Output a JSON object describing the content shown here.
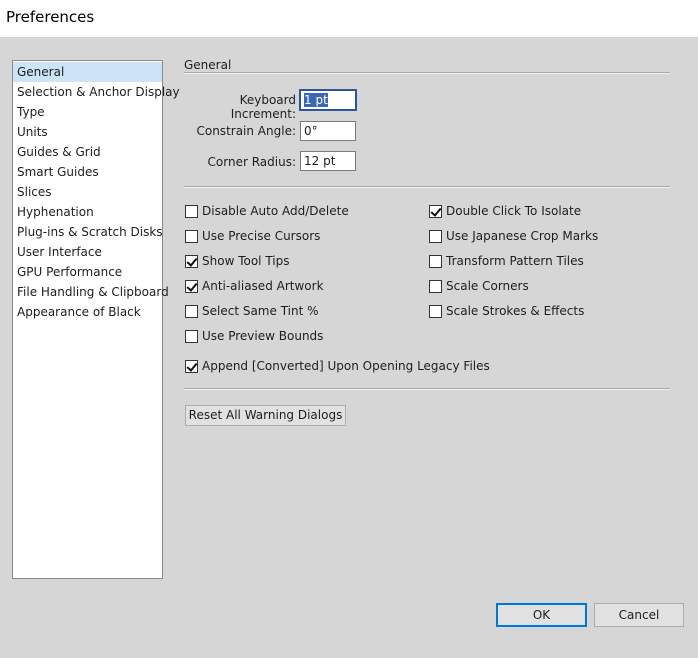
{
  "window": {
    "title": "Preferences"
  },
  "sidebar": {
    "items": [
      {
        "label": "General",
        "selected": true
      },
      {
        "label": "Selection & Anchor Display"
      },
      {
        "label": "Type"
      },
      {
        "label": "Units"
      },
      {
        "label": "Guides & Grid"
      },
      {
        "label": "Smart Guides"
      },
      {
        "label": "Slices"
      },
      {
        "label": "Hyphenation"
      },
      {
        "label": "Plug-ins & Scratch Disks"
      },
      {
        "label": "User Interface"
      },
      {
        "label": "GPU Performance"
      },
      {
        "label": "File Handling & Clipboard"
      },
      {
        "label": "Appearance of Black"
      }
    ]
  },
  "general": {
    "section_title": "General",
    "keyboard_increment": {
      "label": "Keyboard Increment:",
      "value": "1 pt"
    },
    "constrain_angle": {
      "label": "Constrain Angle:",
      "value": "0°"
    },
    "corner_radius": {
      "label": "Corner Radius:",
      "value": "12 pt"
    },
    "checkboxes": {
      "disable_auto_add": {
        "label": "Disable Auto Add/Delete",
        "checked": false
      },
      "double_click_isolate": {
        "label": "Double Click To Isolate",
        "checked": true
      },
      "precise_cursors": {
        "label": "Use Precise Cursors",
        "checked": false
      },
      "japanese_crop_marks": {
        "label": "Use Japanese Crop Marks",
        "checked": false
      },
      "show_tool_tips": {
        "label": "Show Tool Tips",
        "checked": true
      },
      "transform_pattern_tiles": {
        "label": "Transform Pattern Tiles",
        "checked": false
      },
      "anti_aliased_artwork": {
        "label": "Anti-aliased Artwork",
        "checked": true
      },
      "scale_corners": {
        "label": "Scale Corners",
        "checked": false
      },
      "select_same_tint": {
        "label": "Select Same Tint %",
        "checked": false
      },
      "scale_strokes_effects": {
        "label": "Scale Strokes & Effects",
        "checked": false
      },
      "preview_bounds": {
        "label": "Use Preview Bounds",
        "checked": false
      },
      "append_converted": {
        "label": "Append [Converted] Upon Opening Legacy Files",
        "checked": true
      }
    },
    "reset_warnings_label": "Reset All Warning Dialogs"
  },
  "footer": {
    "ok_label": "OK",
    "cancel_label": "Cancel"
  }
}
